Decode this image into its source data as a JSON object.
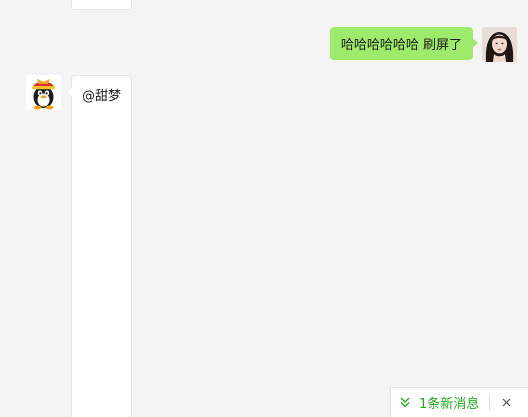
{
  "messages": {
    "outgoing": {
      "text": "哈哈哈哈哈哈 刷屏了",
      "avatar": "user-photo-avatar",
      "bubble_color": "#9eea6a"
    },
    "incoming": {
      "text": "@甜梦",
      "avatar": "penguin-avatar",
      "bubble_color": "#ffffff"
    }
  },
  "new_message_notice": {
    "label": "1条新消息",
    "icon": "double-chevron-down-icon",
    "close_icon": "close-icon",
    "accent_color": "#1aad19"
  },
  "theme": {
    "background": "#f4f4f4"
  }
}
